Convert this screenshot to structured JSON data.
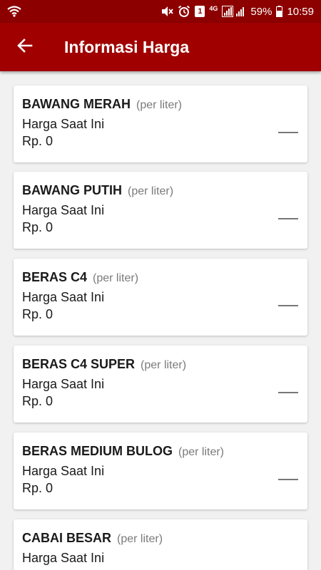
{
  "status_bar": {
    "battery": "59%",
    "time": "10:59",
    "notification_badge": "1",
    "network": "4G",
    "icons": [
      "wifi-icon",
      "mute-icon",
      "alarm-icon",
      "notification-icon",
      "signal-icon",
      "battery-icon"
    ]
  },
  "app_bar": {
    "title": "Informasi Harga",
    "back_icon": "arrow-left-icon"
  },
  "colors": {
    "status_bar": "#8c0000",
    "app_bar": "#a00000",
    "background": "#f1f1f1",
    "card": "#ffffff",
    "unit_text": "#7a7a7a"
  },
  "items": [
    {
      "name": "BAWANG MERAH",
      "unit": "(per liter)",
      "label": "Harga Saat Ini",
      "price": "Rp. 0",
      "trend": "flat"
    },
    {
      "name": "BAWANG PUTIH",
      "unit": "(per liter)",
      "label": "Harga Saat Ini",
      "price": "Rp. 0",
      "trend": "flat"
    },
    {
      "name": "BERAS C4",
      "unit": "(per liter)",
      "label": "Harga Saat Ini",
      "price": "Rp. 0",
      "trend": "flat"
    },
    {
      "name": "BERAS C4 SUPER",
      "unit": "(per liter)",
      "label": "Harga Saat Ini",
      "price": "Rp. 0",
      "trend": "flat"
    },
    {
      "name": "BERAS MEDIUM BULOG",
      "unit": "(per liter)",
      "label": "Harga Saat Ini",
      "price": "Rp. 0",
      "trend": "flat"
    },
    {
      "name": "CABAI BESAR",
      "unit": "(per liter)",
      "label": "Harga Saat Ini",
      "price": "",
      "trend": ""
    }
  ]
}
